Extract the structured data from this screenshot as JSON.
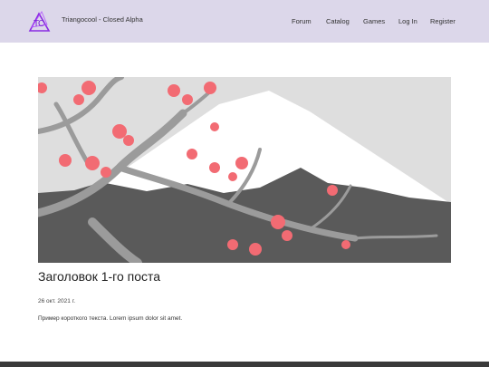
{
  "header": {
    "site_title": "Triangocool - Closed Alpha",
    "logo_icon": "triangle-tc-logo-icon",
    "nav": [
      "Forum",
      "Catalog",
      "Games",
      "Log In",
      "Register"
    ]
  },
  "post": {
    "image_icon": "mount-fuji-sakura-illustration",
    "title": "Заголовок 1-го поста",
    "date": "26 окт. 2021 г.",
    "excerpt": "Пример короткого текста. Lorem ipsum dolor sit amet."
  },
  "colors": {
    "header_bg": "#dcd7ea",
    "accent": "#8a2be2",
    "blossom": "#f26b73",
    "footer": "#3a3a3a"
  }
}
